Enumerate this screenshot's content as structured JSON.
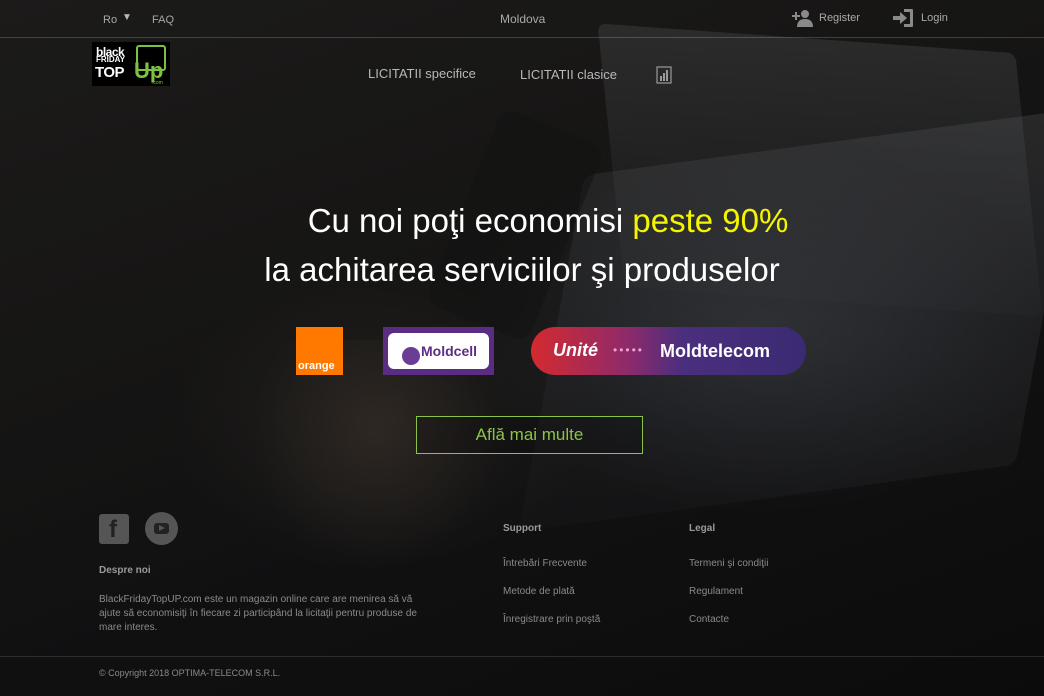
{
  "header": {
    "language": "Ro",
    "faq": "FAQ",
    "region": "Moldova",
    "register": "Register",
    "login": "Login"
  },
  "logo": {
    "line1": "black",
    "line2": "FRIDAY",
    "line3": "TOP",
    "up": "Up",
    "domain": ".com"
  },
  "nav": {
    "item1": "LICITATII specifice",
    "item2": "LICITATII clasice"
  },
  "hero": {
    "line1_prefix": "Cu noi poţi economisi ",
    "line1_highlight": "peste 90%",
    "line2": "la achitarea serviciilor şi produselor",
    "cta": "Află mai multe"
  },
  "partners": {
    "orange": "orange",
    "moldcell": "Moldcell",
    "unite": "Unité",
    "dots": "•••••",
    "moldtelecom": "Moldtelecom"
  },
  "footer": {
    "about_title": "Despre noi",
    "about_text": "BlackFridayTopUP.com este un magazin online care are menirea să vă ajute să economisiţi în fiecare zi participând la licitaţii pentru produse de mare interes.",
    "support_title": "Support",
    "support_items": [
      "Întrebări Frecvente",
      "Metode de plată",
      "Înregistrare prin poştă"
    ],
    "legal_title": "Legal",
    "legal_items": [
      "Termeni şi condiţii",
      "Regulament",
      "Contacte"
    ],
    "copyright": "© Copyright 2018 OPTIMA-TELECOM S.R.L."
  },
  "colors": {
    "highlight": "#f5f500",
    "cta": "#8bc34a",
    "orange": "#ff7900",
    "moldcell": "#5a2d82"
  }
}
